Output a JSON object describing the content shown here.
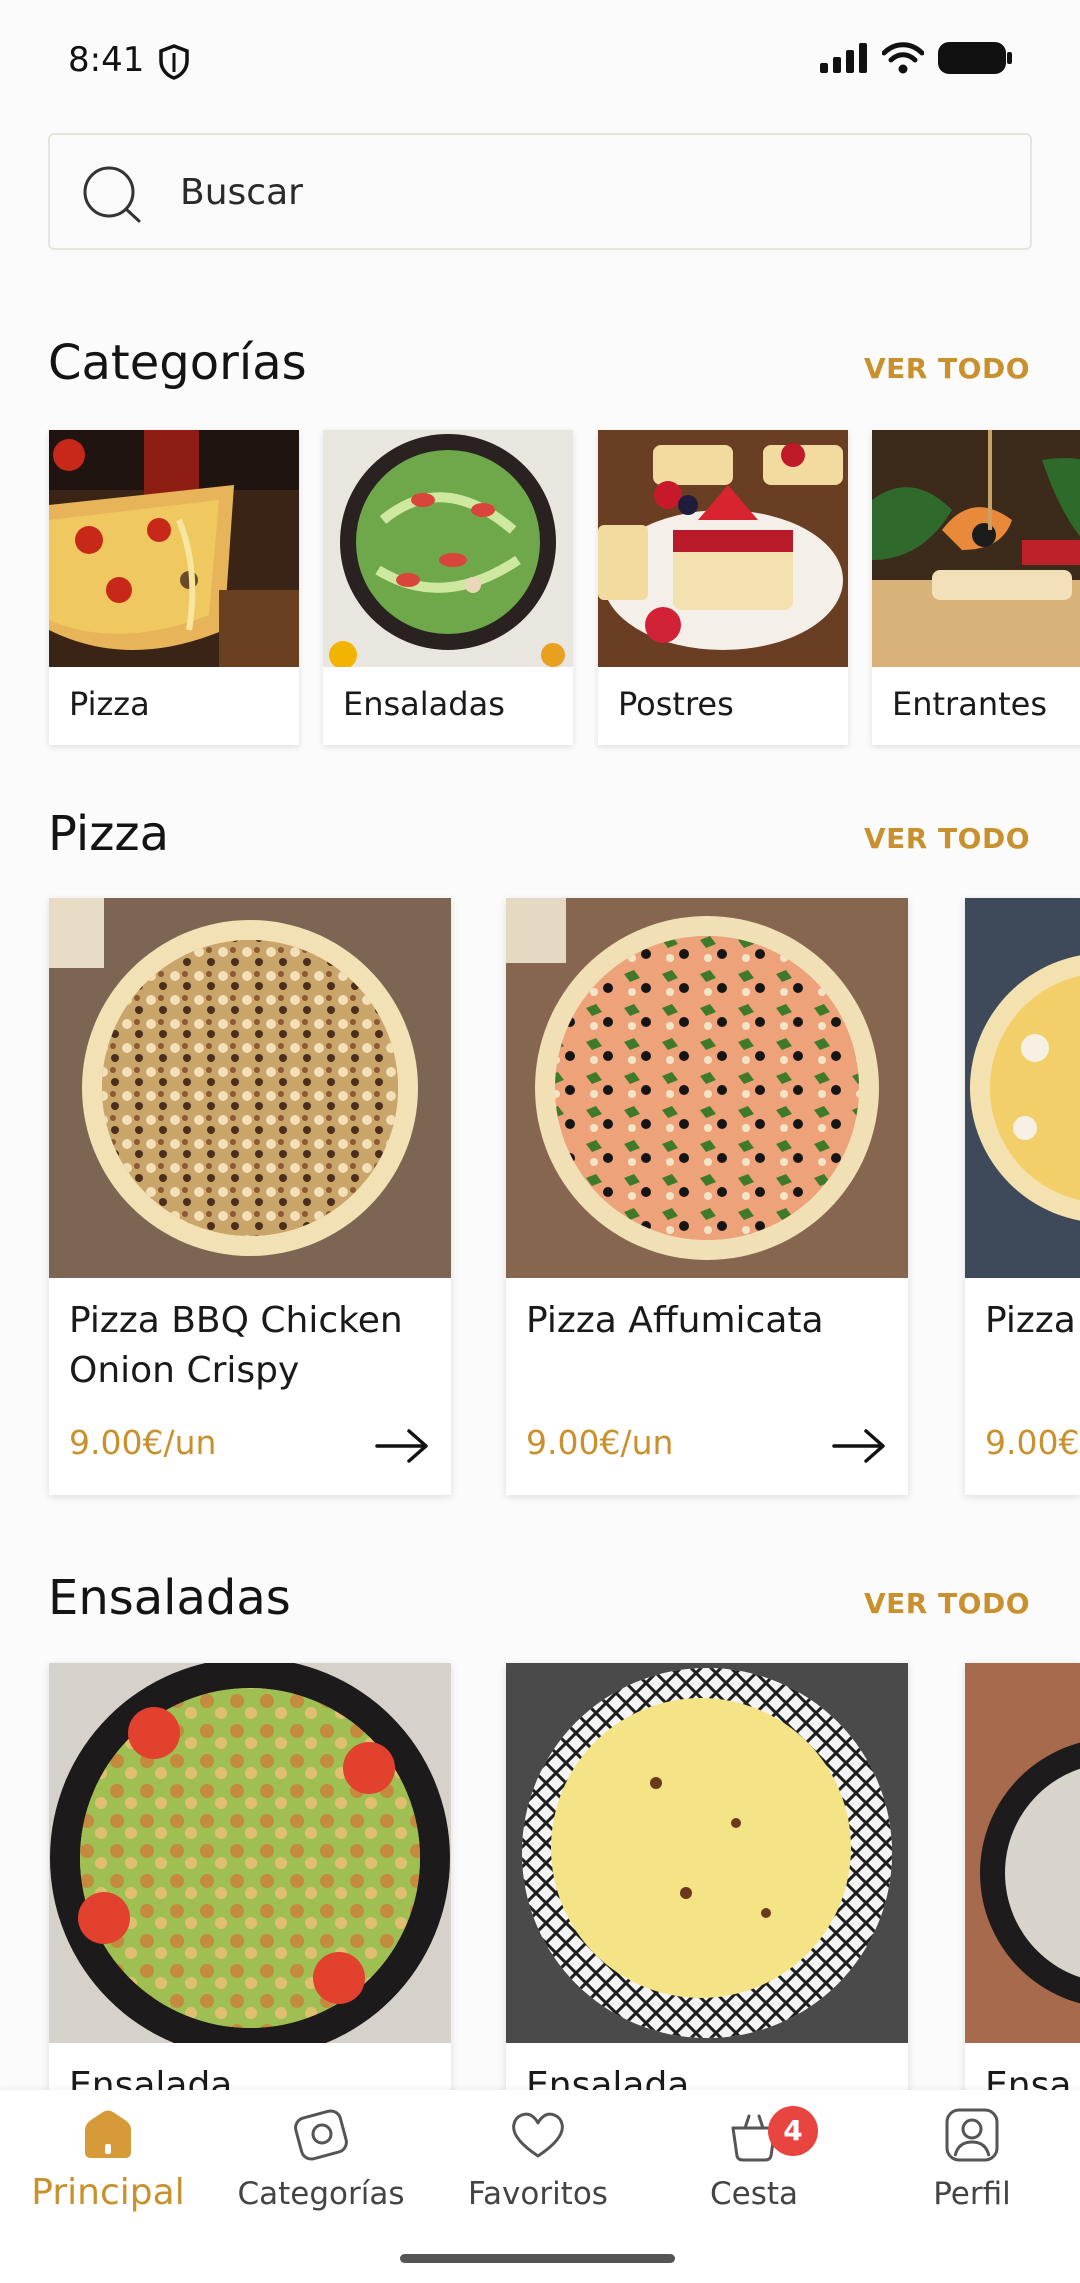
{
  "status_bar": {
    "time": "8:41"
  },
  "search": {
    "placeholder": "Buscar"
  },
  "categories_section": {
    "title": "Categorías",
    "see_all": "VER TODO",
    "items": [
      {
        "label": "Pizza"
      },
      {
        "label": "Ensaladas"
      },
      {
        "label": "Postres"
      },
      {
        "label": "Entrantes"
      }
    ]
  },
  "pizza_section": {
    "title": "Pizza",
    "see_all": "VER TODO",
    "products": [
      {
        "name": "Pizza BBQ Chicken Onion Crispy",
        "price": "9.00€/un"
      },
      {
        "name": "Pizza Affumicata",
        "price": "9.00€/un"
      },
      {
        "name": "Pizza",
        "price": "9.00€"
      }
    ]
  },
  "salads_section": {
    "title": "Ensaladas",
    "see_all": "VER TODO",
    "products": [
      {
        "name": "Ensalada"
      },
      {
        "name": "Ensalada"
      },
      {
        "name": "Ensa"
      }
    ]
  },
  "bottom_nav": {
    "items": [
      {
        "label": "Principal",
        "icon": "home-icon",
        "active": true
      },
      {
        "label": "Categorías",
        "icon": "categories-icon"
      },
      {
        "label": "Favoritos",
        "icon": "heart-icon"
      },
      {
        "label": "Cesta",
        "icon": "basket-icon",
        "badge": "4"
      },
      {
        "label": "Perfil",
        "icon": "profile-icon"
      }
    ]
  },
  "colors": {
    "accent": "#c8912d",
    "badge": "#e84440",
    "background": "#fbfbfb"
  }
}
